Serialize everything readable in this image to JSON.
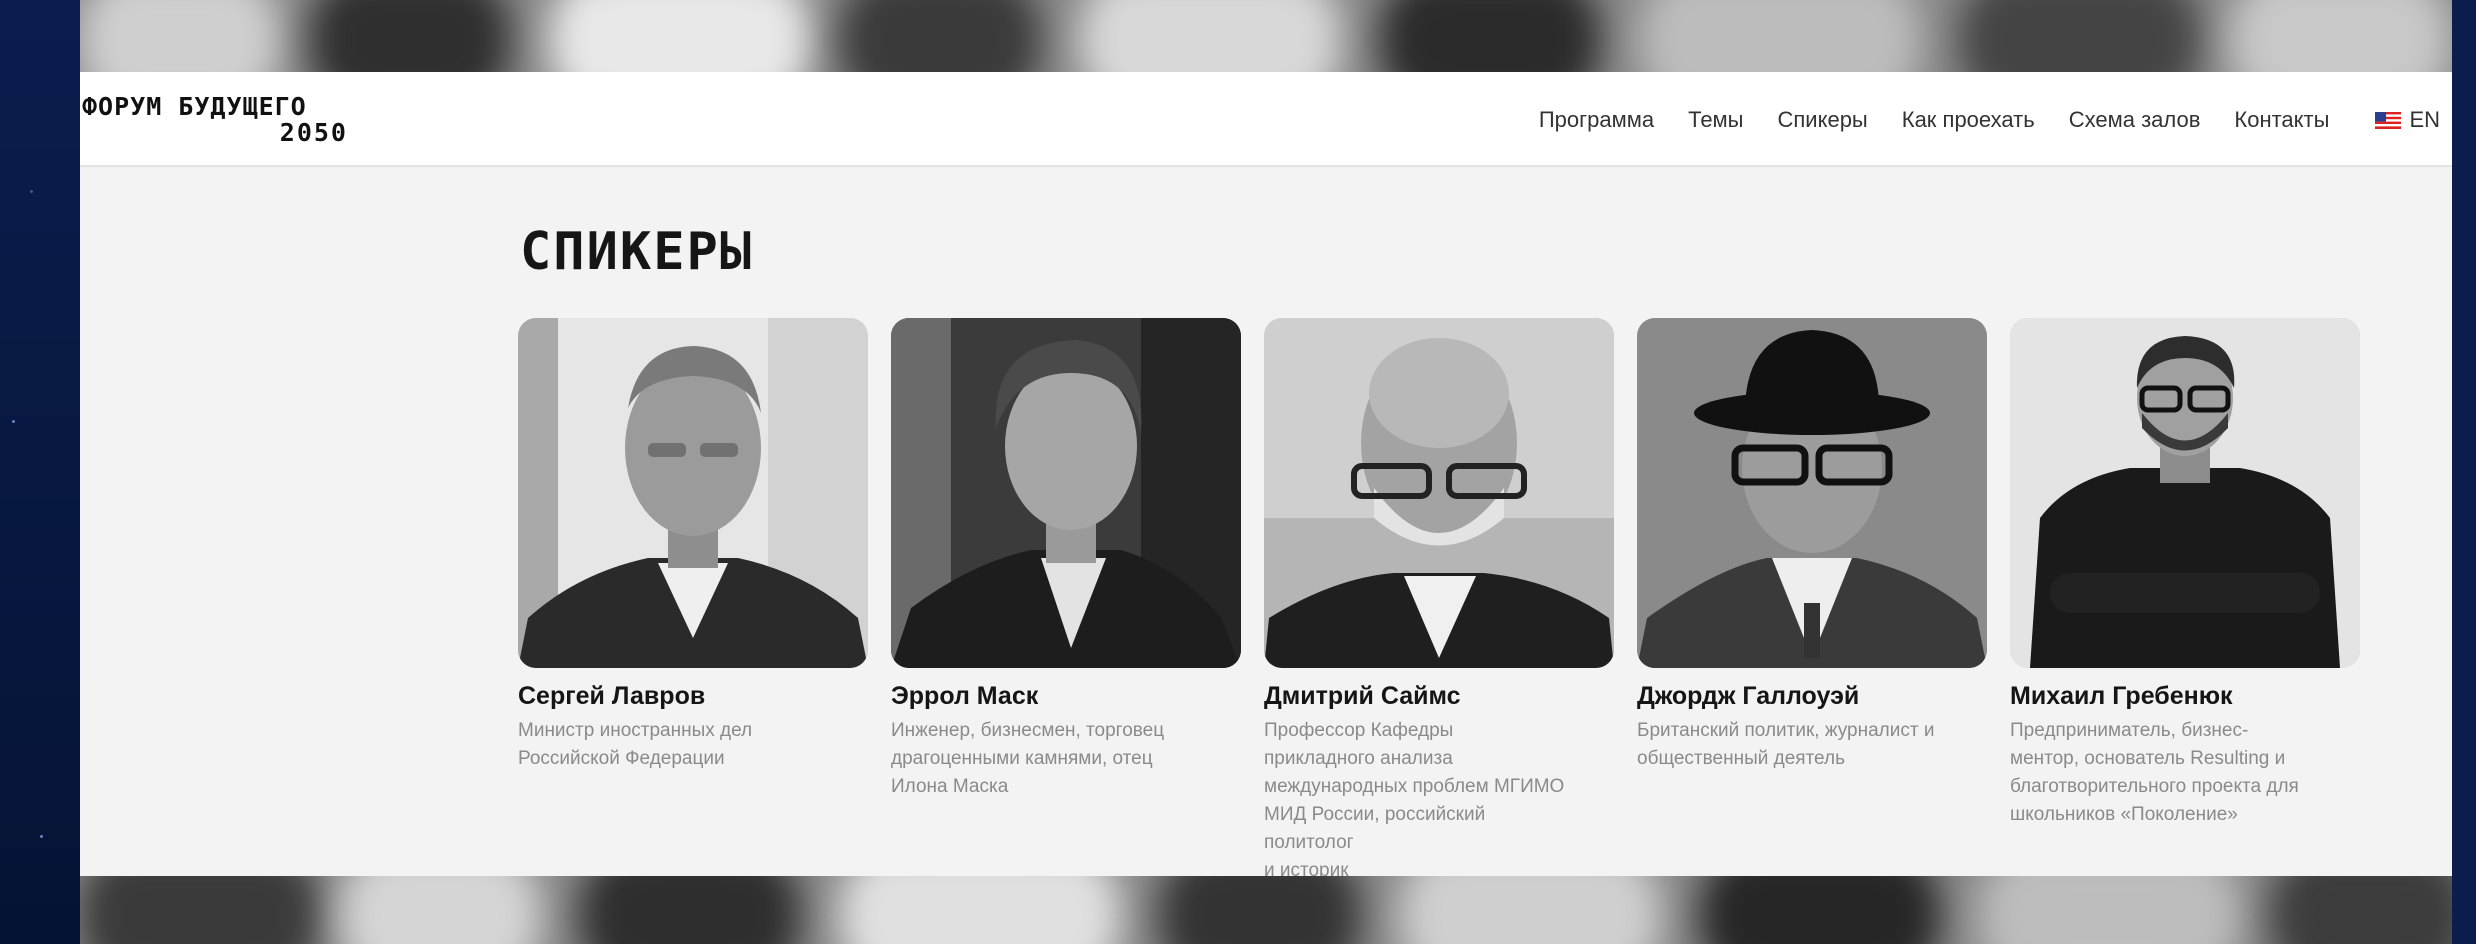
{
  "header": {
    "logo_line1": "ФОРУМ БУДУЩЕГО",
    "logo_line2": "2050",
    "nav": [
      "Программа",
      "Темы",
      "Спикеры",
      "Как проехать",
      "Схема залов",
      "Контакты"
    ],
    "language": {
      "label": "EN",
      "icon": "us-flag-icon"
    }
  },
  "section_title": "СПИКЕРЫ",
  "speakers": [
    {
      "name": "Сергей Лавров",
      "description": "Министр иностранных дел\nРоссийской Федерации"
    },
    {
      "name": "Эррол Маск",
      "description": "Инженер, бизнесмен, торговец\nдрагоценными камнями, отец\nИлона Маска"
    },
    {
      "name": "Дмитрий Саймс",
      "description": "Профессор Кафедры\nприкладного анализа\nмеждународных проблем МГИМО\nМИД России, российский\nполитолог\nи историк"
    },
    {
      "name": "Джордж Галлоуэй",
      "description": "Британский политик, журналист и\nобщественный деятель"
    },
    {
      "name": "Михаил Гребенюк",
      "description": "Предприниматель, бизнес-\nментор, основатель Resulting и\nблаготворительного проекта для\nшкольников «Поколение»"
    }
  ],
  "colors": {
    "frame": "#0a1d4d",
    "panel": "#f3f3f3",
    "name": "#151515",
    "desc": "#8a8a8a"
  }
}
